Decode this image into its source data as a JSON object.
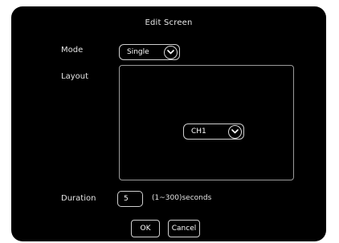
{
  "dialog": {
    "title": "Edit Screen"
  },
  "mode": {
    "label": "Mode",
    "selected": "Single"
  },
  "layout": {
    "label": "Layout",
    "channel_selected": "CH1"
  },
  "duration": {
    "label": "Duration",
    "value": "5",
    "hint": "(1~300)seconds"
  },
  "buttons": {
    "ok_label": "OK",
    "cancel_label": "Cancel"
  },
  "icons": {
    "dropdown": "chevron-down-icon"
  },
  "colors": {
    "background": "#000000",
    "text": "#ffffff",
    "border": "#cfcfcf"
  }
}
